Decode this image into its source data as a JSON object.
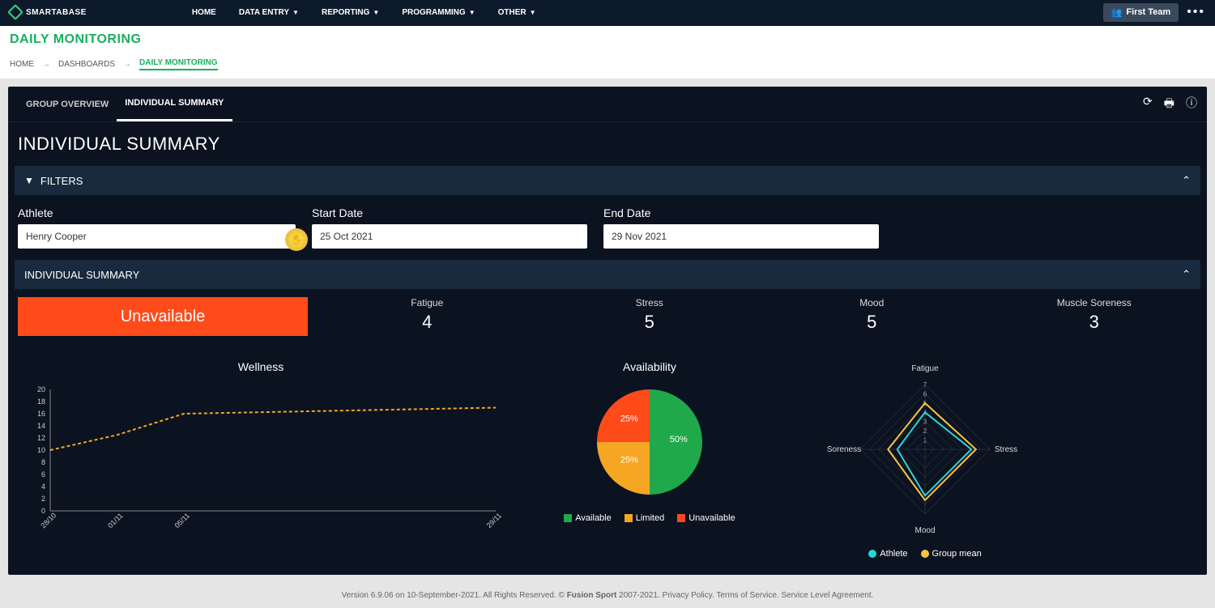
{
  "brand": "SMARTABASE",
  "topnav": [
    "HOME",
    "DATA ENTRY",
    "REPORTING",
    "PROGRAMMING",
    "OTHER"
  ],
  "topnav_has_dropdown": [
    false,
    true,
    true,
    true,
    true
  ],
  "team_button": "First Team",
  "page_title": "DAILY MONITORING",
  "breadcrumb": {
    "home": "HOME",
    "dashboards": "DASHBOARDS",
    "current": "DAILY MONITORING"
  },
  "tabs": {
    "group": "GROUP OVERVIEW",
    "individual": "INDIVIDUAL SUMMARY"
  },
  "section_title": "INDIVIDUAL SUMMARY",
  "filters_label": "FILTERS",
  "filters": {
    "athlete_label": "Athlete",
    "athlete_value": "Henry Cooper",
    "start_label": "Start Date",
    "start_value": "25 Oct 2021",
    "end_label": "End Date",
    "end_value": "29 Nov 2021"
  },
  "summary_header": "INDIVIDUAL SUMMARY",
  "status": "Unavailable",
  "metrics": {
    "fatigue": {
      "label": "Fatigue",
      "value": "4"
    },
    "stress": {
      "label": "Stress",
      "value": "5"
    },
    "mood": {
      "label": "Mood",
      "value": "5"
    },
    "soreness": {
      "label": "Muscle Soreness",
      "value": "3"
    }
  },
  "chart_data": [
    {
      "type": "line",
      "title": "Wellness",
      "x": [
        "28/10",
        "01/11",
        "05/11",
        "29/11"
      ],
      "values": [
        10,
        12.5,
        16,
        17
      ],
      "xlabel": "",
      "ylabel": "",
      "ylim": [
        0,
        20
      ],
      "yticks": [
        0,
        2,
        4,
        6,
        8,
        10,
        12,
        14,
        16,
        18,
        20
      ],
      "color": "#f5a623"
    },
    {
      "type": "pie",
      "title": "Availability",
      "slices": [
        {
          "label": "Available",
          "value": 50,
          "color": "#1fa94b",
          "text": "50%"
        },
        {
          "label": "Limited",
          "value": 25,
          "color": "#f5a623",
          "text": "25%"
        },
        {
          "label": "Unavailable",
          "value": 25,
          "color": "#ff4a1a",
          "text": "25%"
        }
      ],
      "legend": [
        "Available",
        "Limited",
        "Unavailable"
      ]
    },
    {
      "type": "radar",
      "title": "",
      "axes": [
        "Fatigue",
        "Stress",
        "Mood",
        "Soreness"
      ],
      "ticks": [
        1,
        2,
        3,
        4,
        5,
        6,
        7
      ],
      "series": [
        {
          "name": "Athlete",
          "color": "#2bd4d4",
          "values": [
            4,
            5,
            5,
            3
          ]
        },
        {
          "name": "Group mean",
          "color": "#f5c542",
          "values": [
            5,
            5.5,
            5.5,
            4
          ]
        }
      ],
      "legend": [
        "Athlete",
        "Group mean"
      ]
    }
  ],
  "footer": {
    "version": "Version 6.9.06 on 10-September-2021. All Rights Reserved. © ",
    "company": "Fusion Sport",
    "years": " 2007-2021. ",
    "privacy": "Privacy Policy.",
    "terms": "Terms of Service.",
    "sla": "Service Level Agreement."
  }
}
